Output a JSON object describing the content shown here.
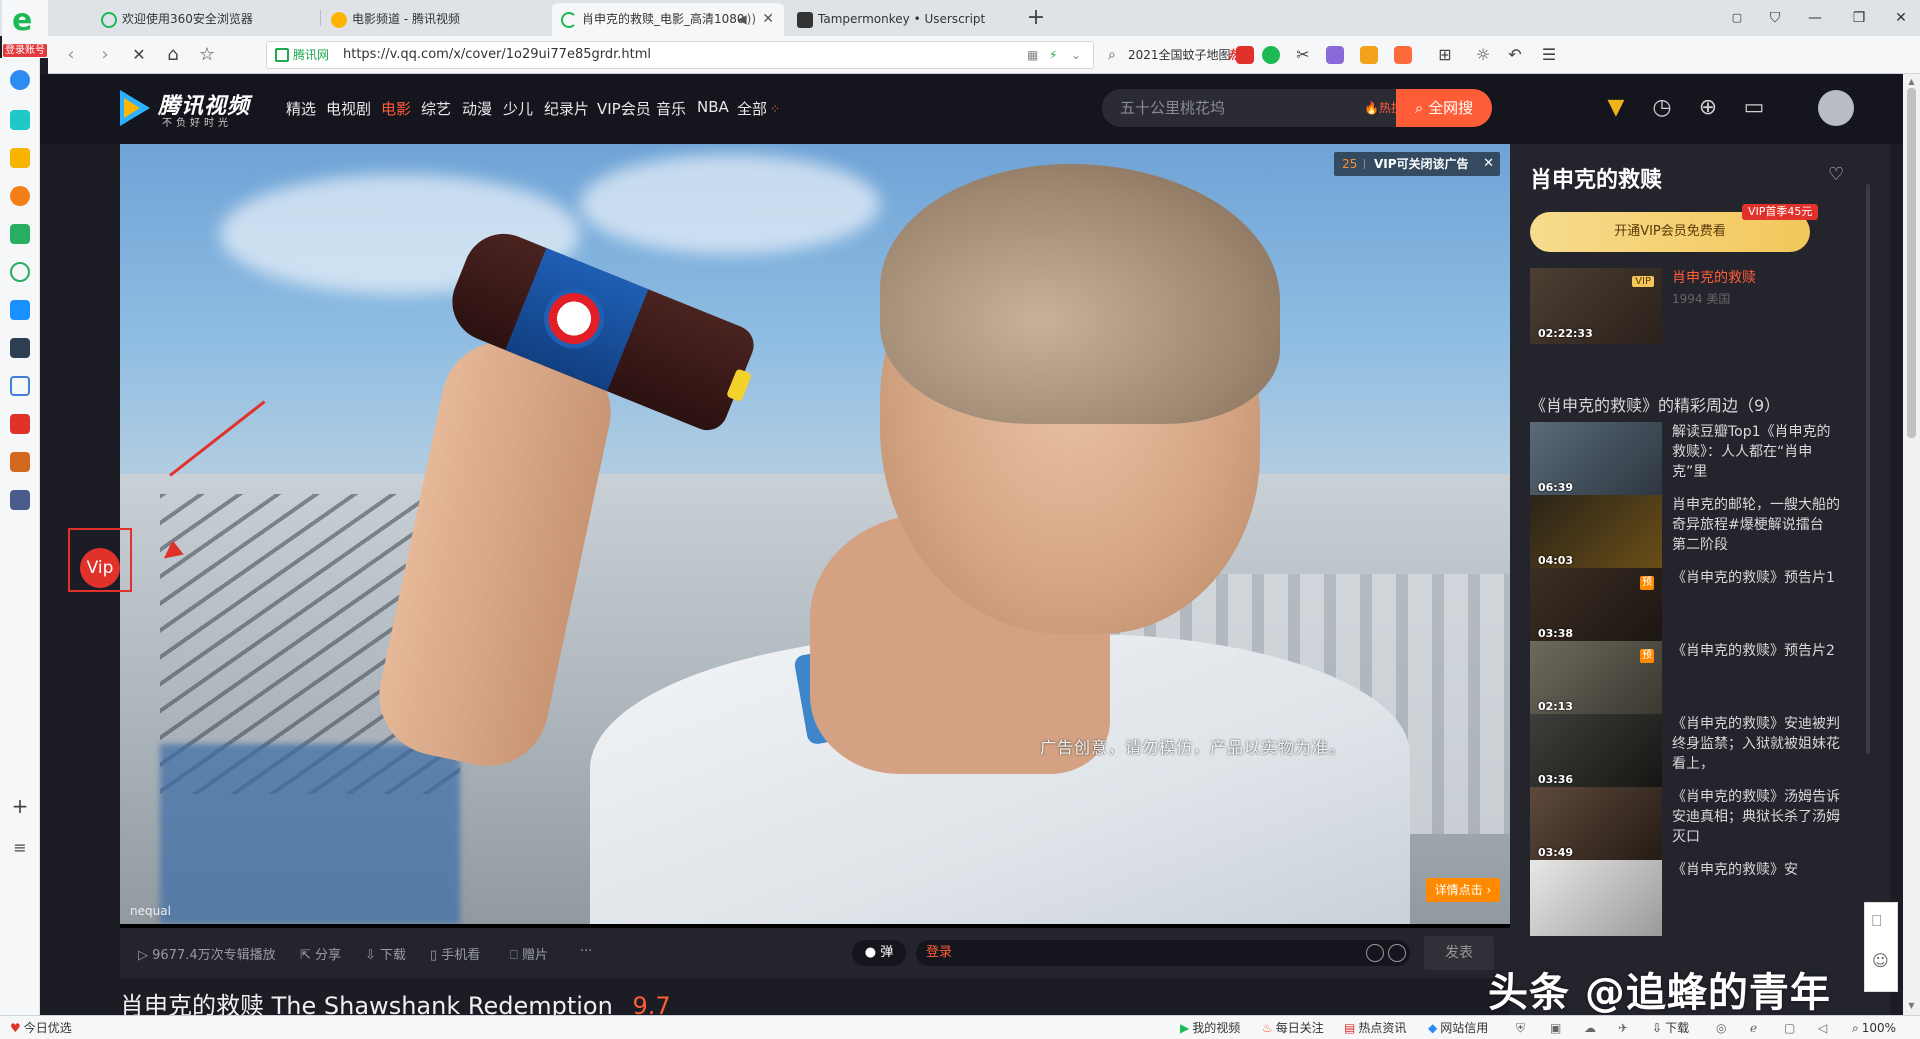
{
  "browser": {
    "logo_badge": "登录账号",
    "tabs": [
      {
        "title": "欢迎使用360安全浏览器",
        "color": "#1db954"
      },
      {
        "title": "电影频道 - 腾讯视频",
        "color": "#ffb400"
      },
      {
        "title": "肖申克的救赎_电影_高清1080",
        "color": "#1db954"
      },
      {
        "title": "Tampermonkey • Userscript",
        "color": "#333333"
      }
    ],
    "site_label": "腾讯网",
    "url": "https://v.qq.com/x/cover/1o29ui77e85grdr.html",
    "hot_search": "2021全国蚊子地图",
    "hot_label": "热搜"
  },
  "sidebar_icons": [
    "compass-icon",
    "plus-square-icon",
    "star-icon",
    "weibo-icon",
    "mail-icon",
    "cloud-icon",
    "p-icon",
    "news-icon",
    "doc-icon",
    "red-icon",
    "game-icon",
    "game2-icon"
  ],
  "site": {
    "logo_name": "腾讯视频",
    "slogan": "不负好时光",
    "nav": [
      "精选",
      "电视剧",
      "电影",
      "综艺",
      "动漫",
      "少儿",
      "纪录片",
      "VIP会员",
      "音乐",
      "NBA",
      "全部"
    ],
    "active_nav": "电影",
    "search_placeholder": "五十公里桃花坞",
    "hot_list": "热搜榜",
    "search_button": "全网搜"
  },
  "player": {
    "ad_countdown": "25",
    "ad_close_text": "VIP可关闭该广告",
    "subtitle": "广告创意，请勿模仿，产品以实物为准。",
    "detail_button": "详情点击",
    "watermark": "nequal",
    "vip_float": "Vip",
    "controls": {
      "plays": "9677.4万次专辑播放",
      "share": "分享",
      "download": "下载",
      "mobile": "手机看",
      "gift": "赠片",
      "more": "···",
      "danmu": "弹",
      "login": "登录",
      "send": "发表"
    }
  },
  "title": {
    "cn": "肖申克的救赎",
    "en": "The Shawshank Redemption",
    "score": "9.7"
  },
  "panel": {
    "title": "肖申克的救赎",
    "vip_button": "开通VIP会员免费看",
    "vip_tag": "VIP首季45元",
    "main_item": {
      "title": "肖申克的救赎",
      "sub": "1994 美国",
      "duration": "02:22:33",
      "tag": "VIP"
    },
    "section": "《肖申克的救赎》的精彩周边（9）",
    "items": [
      {
        "title": "解读豆瓣Top1《肖申克的救赎》：人人都在“肖申克”里",
        "duration": "06:39",
        "tag": ""
      },
      {
        "title": "肖申克的邮轮，一艘大船的奇异旅程#爆梗解说擂台 第二阶段",
        "duration": "04:03",
        "tag": ""
      },
      {
        "title": "《肖申克的救赎》预告片1",
        "duration": "03:38",
        "tag": "预"
      },
      {
        "title": "《肖申克的救赎》预告片2",
        "duration": "02:13",
        "tag": "预"
      },
      {
        "title": "《肖申克的救赎》安迪被判终身监禁；入狱就被姐妹花看上，",
        "duration": "03:36",
        "tag": ""
      },
      {
        "title": "《肖申克的救赎》汤姆告诉安迪真相；典狱长杀了汤姆灭口",
        "duration": "03:49",
        "tag": ""
      },
      {
        "title": "《肖申克的救赎》安",
        "duration": "",
        "tag": ""
      }
    ]
  },
  "overlay_watermark": "头条 @追蜂的青年",
  "statusbar": {
    "left": "今日优选",
    "items": [
      "我的视频",
      "每日关注",
      "热点资讯",
      "网站信用"
    ],
    "download": "下载",
    "zoom": "100%"
  }
}
